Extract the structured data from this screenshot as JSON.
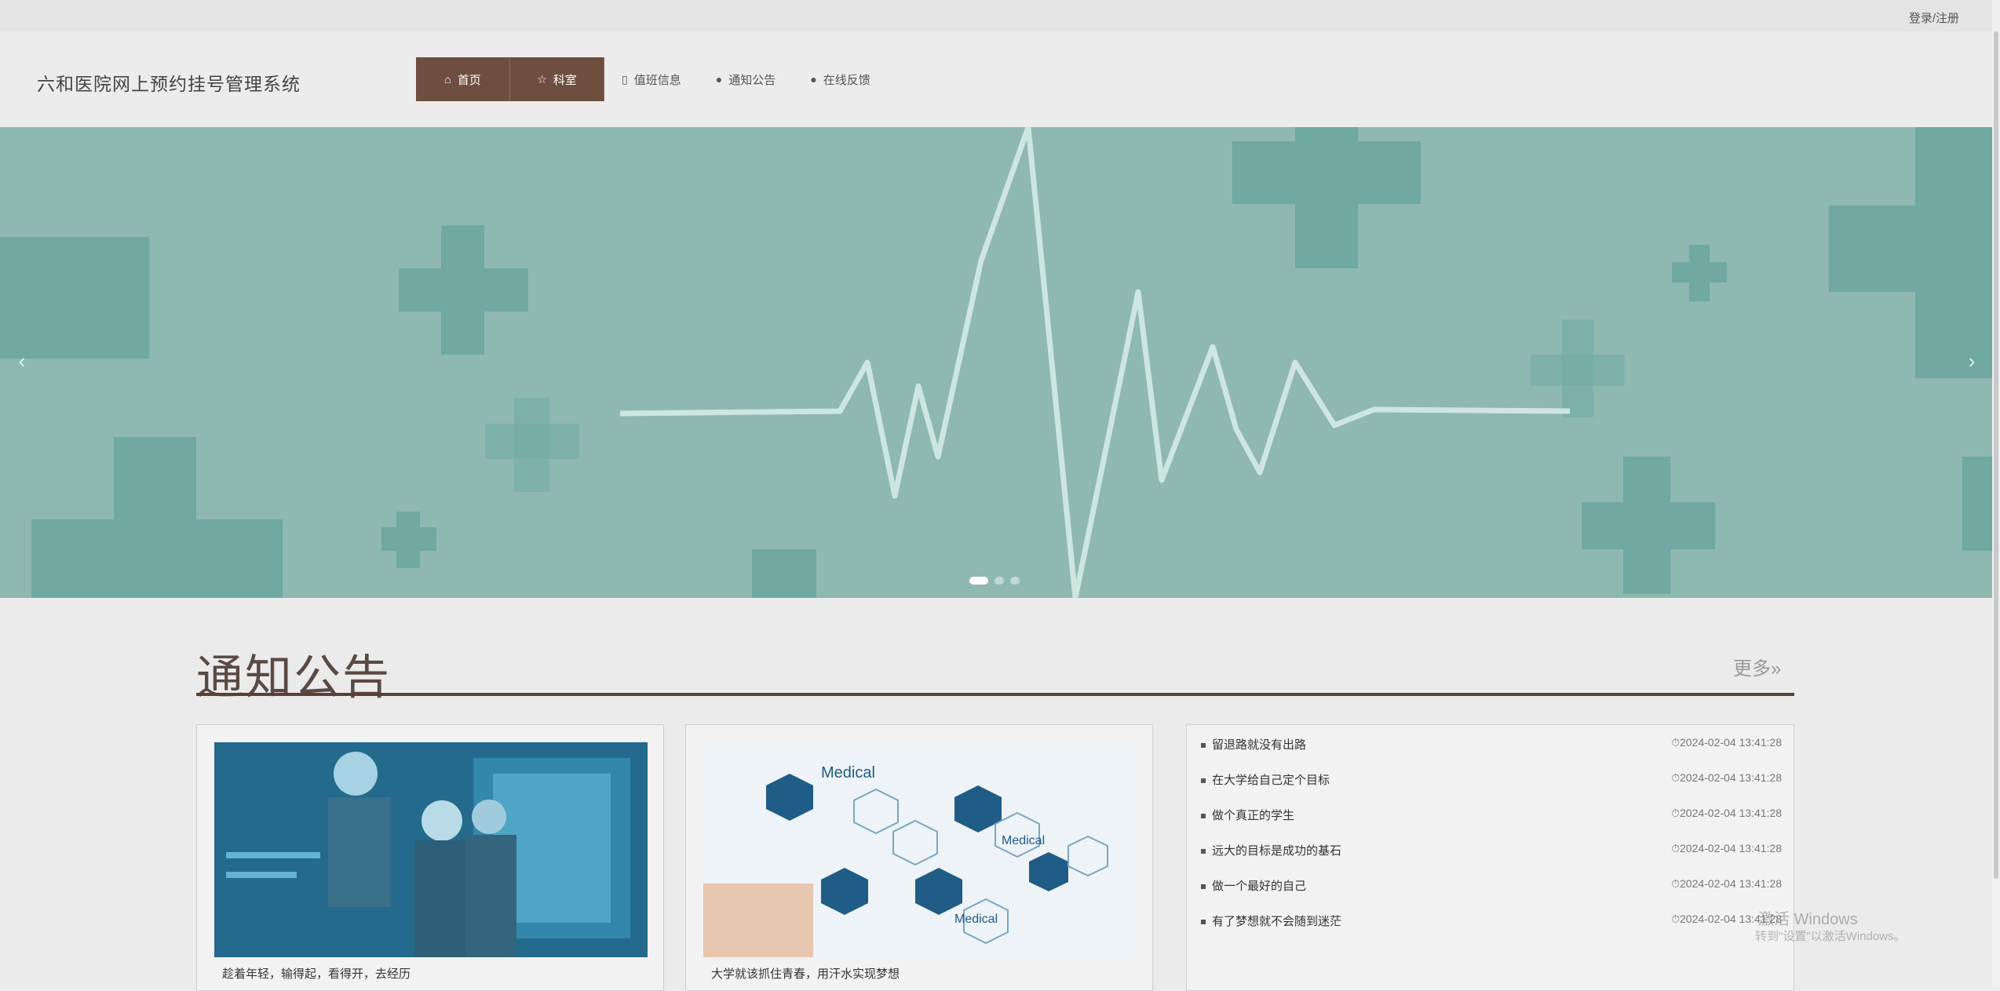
{
  "topbar": {
    "login_label": "登录/注册"
  },
  "header": {
    "site_title": "六和医院网上预约挂号管理系统",
    "nav": [
      {
        "label": "首页",
        "icon": "home-icon"
      },
      {
        "label": "科室",
        "icon": "star-icon"
      },
      {
        "label": "值班信息",
        "icon": "calendar-icon"
      },
      {
        "label": "通知公告",
        "icon": "info-icon"
      },
      {
        "label": "在线反馈",
        "icon": "question-icon"
      }
    ]
  },
  "banner": {
    "active_slide": 1,
    "slide_count": 3
  },
  "notices": {
    "title": "通知公告",
    "more_label": "更多»",
    "cards": [
      {
        "caption": "趁着年轻，输得起，看得开，去经历"
      },
      {
        "caption": "大学就该抓住青春，用汗水实现梦想"
      }
    ],
    "list": [
      {
        "title": "留退路就没有出路",
        "date": "2024-02-04 13:41:28"
      },
      {
        "title": "在大学给自己定个目标",
        "date": "2024-02-04 13:41:28"
      },
      {
        "title": "做个真正的学生",
        "date": "2024-02-04 13:41:28"
      },
      {
        "title": "远大的目标是成功的基石",
        "date": "2024-02-04 13:41:28"
      },
      {
        "title": "做一个最好的自己",
        "date": "2024-02-04 13:41:28"
      },
      {
        "title": "有了梦想就不会随到迷茫",
        "date": "2024-02-04 13:41:28"
      }
    ]
  },
  "watermark": {
    "line1": "激活 Windows",
    "line2": "转到\"设置\"以激活Windows。"
  }
}
